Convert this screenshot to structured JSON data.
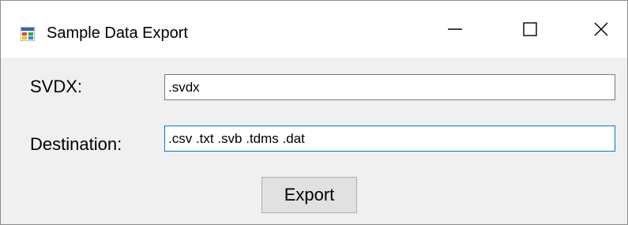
{
  "window": {
    "title": "Sample Data Export",
    "icon": "windows-form-icon"
  },
  "controls": {
    "minimize_icon": "minimize-icon",
    "maximize_icon": "maximize-icon",
    "close_icon": "close-icon"
  },
  "form": {
    "svdx_label": "SVDX:",
    "svdx_value": ".svdx",
    "destination_label": "Destination:",
    "destination_value": ".csv .txt .svb .tdms .dat",
    "export_label": "Export"
  },
  "colors": {
    "window_background": "#f0f0f0",
    "focus_border": "#0078d7"
  }
}
